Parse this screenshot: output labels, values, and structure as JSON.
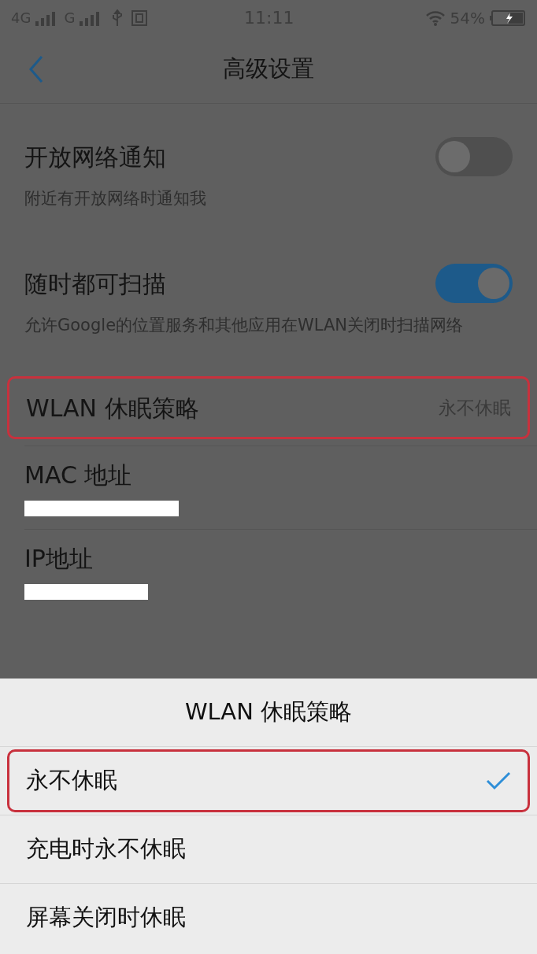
{
  "status_bar": {
    "network_1": "4G",
    "network_2": "G",
    "time": "11:11",
    "battery": "54%",
    "charging": true
  },
  "header": {
    "title": "高级设置"
  },
  "settings": [
    {
      "kind": "toggle",
      "label": "开放网络通知",
      "description": "附近有开放网络时通知我",
      "on": false
    },
    {
      "kind": "toggle",
      "label": "随时都可扫描",
      "description": "允许Google的位置服务和其他应用在WLAN关闭时扫描网络",
      "on": true
    },
    {
      "kind": "value",
      "label": "WLAN 休眠策略",
      "value": "永不休眠",
      "highlighted": true
    },
    {
      "kind": "redacted",
      "label": "MAC 地址"
    },
    {
      "kind": "redacted",
      "label": "IP地址"
    }
  ],
  "sheet": {
    "title": "WLAN 休眠策略",
    "options": [
      {
        "label": "永不休眠",
        "selected": true,
        "highlighted": true
      },
      {
        "label": "充电时永不休眠",
        "selected": false,
        "highlighted": false
      },
      {
        "label": "屏幕关闭时休眠",
        "selected": false,
        "highlighted": false
      }
    ]
  }
}
